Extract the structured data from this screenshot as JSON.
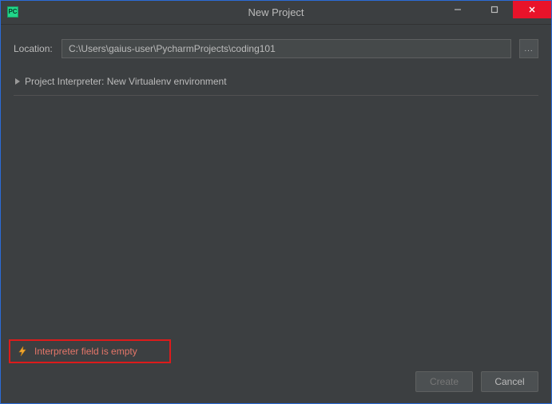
{
  "window": {
    "title": "New Project"
  },
  "location": {
    "label": "Location:",
    "value": "C:\\Users\\gaius-user\\PycharmProjects\\coding101",
    "browse_label": "..."
  },
  "interpreter": {
    "expander_label": "Project Interpreter: New Virtualenv environment"
  },
  "error": {
    "message": "Interpreter field is empty",
    "icon": "warning-bolt"
  },
  "footer": {
    "create_label": "Create",
    "cancel_label": "Cancel"
  },
  "colors": {
    "window_border": "#2b6cd8",
    "background": "#3c3f41",
    "error_border": "#dd1b1b",
    "error_text": "#e47669",
    "close_button": "#e8132a"
  }
}
